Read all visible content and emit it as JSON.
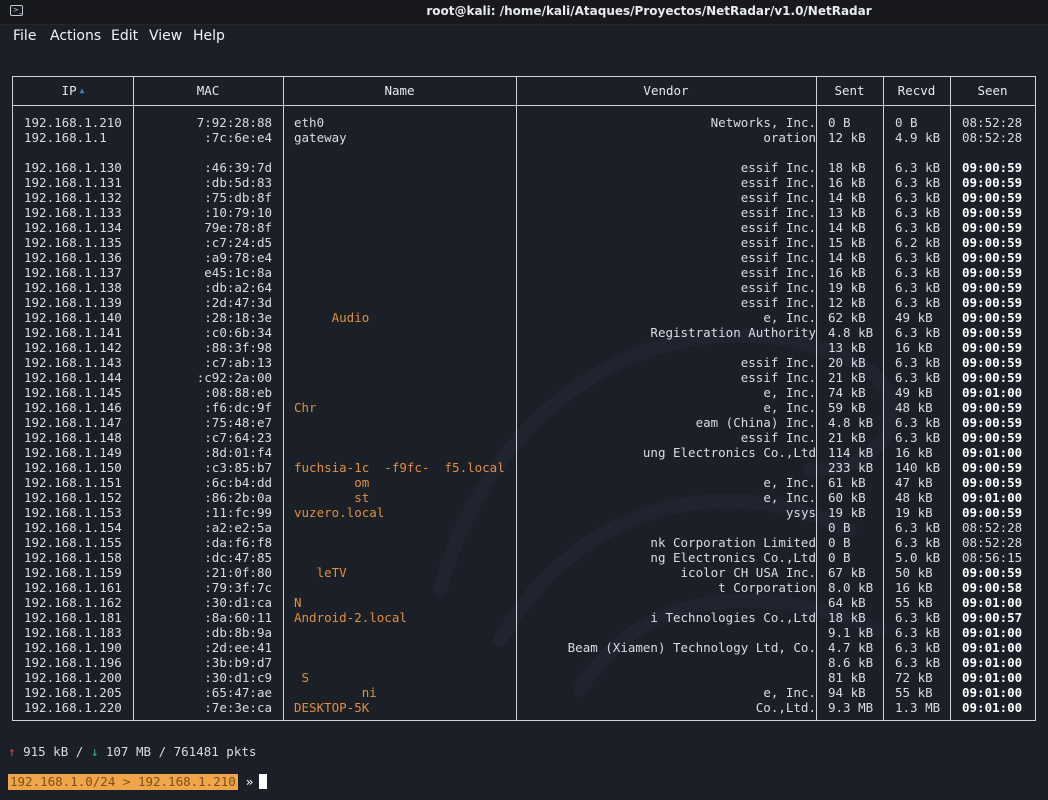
{
  "window": {
    "title": "root@kali: /home/kali/Ataques/Proyectos/NetRadar/v1.0/NetRadar"
  },
  "menu": [
    "File",
    "Actions",
    "Edit",
    "View",
    "Help"
  ],
  "table": {
    "columns": [
      "IP",
      "MAC",
      "Name",
      "Vendor",
      "Sent",
      "Recvd",
      "Seen"
    ],
    "sorted_by": "IP",
    "rows": [
      {
        "ip": "192.168.1.210",
        "mac": "7:92:28:88",
        "name": "eth0",
        "name_style": "plain",
        "vendor": "Networks, Inc.",
        "sent": "0 B",
        "recvd": "0 B",
        "seen": "08:52:28",
        "bold": false
      },
      {
        "ip": "192.168.1.1",
        "mac": ":7c:6e:e4",
        "name": "gateway",
        "name_style": "plain",
        "vendor": "oration",
        "sent": "12 kB",
        "recvd": "4.9 kB",
        "seen": "08:52:28",
        "bold": false
      },
      {
        "gap": true
      },
      {
        "ip": "192.168.1.130",
        "mac": ":46:39:7d",
        "name": "",
        "vendor": "essif Inc.",
        "sent": "18 kB",
        "recvd": "6.3 kB",
        "seen": "09:00:59",
        "bold": true
      },
      {
        "ip": "192.168.1.131",
        "mac": ":db:5d:83",
        "name": "",
        "vendor": "essif Inc.",
        "sent": "16 kB",
        "recvd": "6.3 kB",
        "seen": "09:00:59",
        "bold": true
      },
      {
        "ip": "192.168.1.132",
        "mac": ":75:db:8f",
        "name": "",
        "vendor": "essif Inc.",
        "sent": "14 kB",
        "recvd": "6.3 kB",
        "seen": "09:00:59",
        "bold": true
      },
      {
        "ip": "192.168.1.133",
        "mac": ":10:79:10",
        "name": "",
        "vendor": "essif Inc.",
        "sent": "13 kB",
        "recvd": "6.3 kB",
        "seen": "09:00:59",
        "bold": true
      },
      {
        "ip": "192.168.1.134",
        "mac": "79e:78:8f",
        "name": "",
        "vendor": "essif Inc.",
        "sent": "14 kB",
        "recvd": "6.3 kB",
        "seen": "09:00:59",
        "bold": true
      },
      {
        "ip": "192.168.1.135",
        "mac": ":c7:24:d5",
        "name": "",
        "vendor": "essif Inc.",
        "sent": "15 kB",
        "recvd": "6.2 kB",
        "seen": "09:00:59",
        "bold": true
      },
      {
        "ip": "192.168.1.136",
        "mac": ":a9:78:e4",
        "name": "",
        "vendor": "essif Inc.",
        "sent": "14 kB",
        "recvd": "6.3 kB",
        "seen": "09:00:59",
        "bold": true
      },
      {
        "ip": "192.168.1.137",
        "mac": "e45:1c:8a",
        "name": "",
        "vendor": "essif Inc.",
        "sent": "16 kB",
        "recvd": "6.3 kB",
        "seen": "09:00:59",
        "bold": true
      },
      {
        "ip": "192.168.1.138",
        "mac": ":db:a2:64",
        "name": "",
        "vendor": "essif Inc.",
        "sent": "19 kB",
        "recvd": "6.3 kB",
        "seen": "09:00:59",
        "bold": true
      },
      {
        "ip": "192.168.1.139",
        "mac": ":2d:47:3d",
        "name": "",
        "vendor": "essif Inc.",
        "sent": "12 kB",
        "recvd": "6.3 kB",
        "seen": "09:00:59",
        "bold": true
      },
      {
        "ip": "192.168.1.140",
        "mac": ":28:18:3e",
        "name": "     Audio",
        "vendor": "e, Inc.",
        "sent": "62 kB",
        "recvd": "49 kB",
        "seen": "09:00:59",
        "bold": true
      },
      {
        "ip": "192.168.1.141",
        "mac": ":c0:6b:34",
        "name": "",
        "vendor": "Registration Authority",
        "sent": "4.8 kB",
        "recvd": "6.3 kB",
        "seen": "09:00:59",
        "bold": true
      },
      {
        "ip": "192.168.1.142",
        "mac": ":88:3f:98",
        "name": "",
        "vendor": "",
        "sent": "13 kB",
        "recvd": "16 kB",
        "seen": "09:00:59",
        "bold": true
      },
      {
        "ip": "192.168.1.143",
        "mac": ":c7:ab:13",
        "name": "",
        "vendor": "essif Inc.",
        "sent": "20 kB",
        "recvd": "6.3 kB",
        "seen": "09:00:59",
        "bold": true
      },
      {
        "ip": "192.168.1.144",
        "mac": ":c92:2a:00",
        "name": "",
        "vendor": "essif Inc.",
        "sent": "21 kB",
        "recvd": "6.3 kB",
        "seen": "09:00:59",
        "bold": true
      },
      {
        "ip": "192.168.1.145",
        "mac": ":08:88:eb",
        "name": "",
        "vendor": "e, Inc.",
        "sent": "74 kB",
        "recvd": "49 kB",
        "seen": "09:01:00",
        "bold": true
      },
      {
        "ip": "192.168.1.146",
        "mac": ":f6:dc:9f",
        "name": "Chr",
        "vendor": "e, Inc.",
        "sent": "59 kB",
        "recvd": "48 kB",
        "seen": "09:00:59",
        "bold": true
      },
      {
        "ip": "192.168.1.147",
        "mac": ":75:48:e7",
        "name": "",
        "vendor": "eam (China) Inc.",
        "sent": "4.8 kB",
        "recvd": "6.3 kB",
        "seen": "09:00:59",
        "bold": true
      },
      {
        "ip": "192.168.1.148",
        "mac": ":c7:64:23",
        "name": "",
        "vendor": "essif Inc.",
        "sent": "21 kB",
        "recvd": "6.3 kB",
        "seen": "09:00:59",
        "bold": true
      },
      {
        "ip": "192.168.1.149",
        "mac": ":8d:01:f4",
        "name": "",
        "vendor": "ung Electronics Co.,Ltd",
        "sent": "114 kB",
        "recvd": "16 kB",
        "seen": "09:01:00",
        "bold": true
      },
      {
        "ip": "192.168.1.150",
        "mac": ":c3:85:b7",
        "name": "fuchsia-1c  -f9fc-  f5.local",
        "vendor": "",
        "sent": "233 kB",
        "recvd": "140 kB",
        "seen": "09:00:59",
        "bold": true
      },
      {
        "ip": "192.168.1.151",
        "mac": ":6c:b4:dd",
        "name": "        om",
        "vendor": "e, Inc.",
        "sent": "61 kB",
        "recvd": "47 kB",
        "seen": "09:00:59",
        "bold": true
      },
      {
        "ip": "192.168.1.152",
        "mac": ":86:2b:0a",
        "name": "        st",
        "vendor": "e, Inc.",
        "sent": "60 kB",
        "recvd": "48 kB",
        "seen": "09:01:00",
        "bold": true
      },
      {
        "ip": "192.168.1.153",
        "mac": ":11:fc:99",
        "name": "vuzero.local",
        "vendor": "ysys",
        "sent": "19 kB",
        "recvd": "19 kB",
        "seen": "09:00:59",
        "bold": true
      },
      {
        "ip": "192.168.1.154",
        "mac": ":a2:e2:5a",
        "name": "",
        "vendor": "",
        "sent": "0 B",
        "recvd": "6.3 kB",
        "seen": "08:52:28",
        "bold": false
      },
      {
        "ip": "192.168.1.155",
        "mac": ":da:f6:f8",
        "name": "",
        "vendor": "nk Corporation Limited",
        "sent": "0 B",
        "recvd": "6.3 kB",
        "seen": "08:52:28",
        "bold": false
      },
      {
        "ip": "192.168.1.158",
        "mac": ":dc:47:85",
        "name": "",
        "vendor": "ng Electronics Co.,Ltd",
        "sent": "0 B",
        "recvd": "5.0 kB",
        "seen": "08:56:15",
        "bold": false
      },
      {
        "ip": "192.168.1.159",
        "mac": ":21:0f:80",
        "name": "   leTV",
        "vendor": "icolor CH USA Inc.",
        "sent": "67 kB",
        "recvd": "50 kB",
        "seen": "09:00:59",
        "bold": true
      },
      {
        "ip": "192.168.1.161",
        "mac": ":79:3f:7c",
        "name": "",
        "vendor": "t Corporation",
        "sent": "8.0 kB",
        "recvd": "16 kB",
        "seen": "09:00:58",
        "bold": true
      },
      {
        "ip": "192.168.1.162",
        "mac": ":30:d1:ca",
        "name": "N",
        "vendor": "",
        "sent": "64 kB",
        "recvd": "55 kB",
        "seen": "09:01:00",
        "bold": true
      },
      {
        "ip": "192.168.1.181",
        "mac": ":8a:60:11",
        "name": "Android-2.local",
        "vendor": "i Technologies Co.,Ltd",
        "sent": "18 kB",
        "recvd": "6.3 kB",
        "seen": "09:00:57",
        "bold": true
      },
      {
        "ip": "192.168.1.183",
        "mac": ":db:8b:9a",
        "name": "",
        "vendor": "",
        "sent": "9.1 kB",
        "recvd": "6.3 kB",
        "seen": "09:01:00",
        "bold": true
      },
      {
        "ip": "192.168.1.190",
        "mac": ":2d:ee:41",
        "name": "",
        "vendor": "Beam (Xiamen) Technology Ltd, Co.",
        "sent": "4.7 kB",
        "recvd": "6.3 kB",
        "seen": "09:01:00",
        "bold": true
      },
      {
        "ip": "192.168.1.196",
        "mac": ":3b:b9:d7",
        "name": "",
        "vendor": "",
        "sent": "8.6 kB",
        "recvd": "6.3 kB",
        "seen": "09:01:00",
        "bold": true
      },
      {
        "ip": "192.168.1.200",
        "mac": ":30:d1:c9",
        "name": " S",
        "vendor": "",
        "sent": "81 kB",
        "recvd": "72 kB",
        "seen": "09:01:00",
        "bold": true
      },
      {
        "ip": "192.168.1.205",
        "mac": ":65:47:ae",
        "name": "         ni",
        "vendor": "e, Inc.",
        "sent": "94 kB",
        "recvd": "55 kB",
        "seen": "09:01:00",
        "bold": true
      },
      {
        "ip": "192.168.1.220",
        "mac": ":7e:3e:ca",
        "name": "DESKTOP-5K",
        "vendor": "Co.,Ltd.",
        "sent": "9.3 MB",
        "recvd": "1.3 MB",
        "seen": "09:01:00",
        "bold": true
      }
    ]
  },
  "status": {
    "up": "915 kB",
    "down": "107 MB",
    "pkts": "761481 pkts",
    "up_arrow": "↑",
    "down_arrow": "↓",
    "sep": "/"
  },
  "prompt": {
    "network": "192.168.1.0/24",
    "arrow": ">",
    "host": "192.168.1.210",
    "chevron": "»"
  },
  "colors": {
    "background": "#1b1f27",
    "name_accent": "#e08f3e",
    "prompt_bg": "#f0a54a",
    "sort_arrow": "#3f7bd4"
  }
}
